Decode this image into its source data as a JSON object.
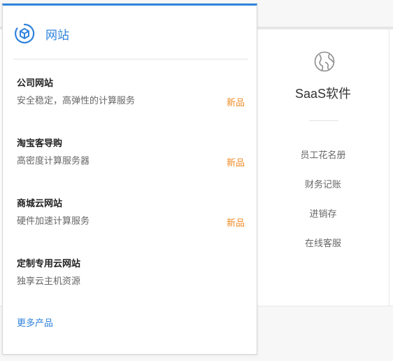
{
  "panel": {
    "title": "网站",
    "icon": "website-cube-icon",
    "accent_color": "#2f83db",
    "products": [
      {
        "name": "公司网站",
        "desc": "安全稳定，高弹性的计算服务",
        "badge": "新品"
      },
      {
        "name": "淘宝客导购",
        "desc": "高密度计算服务器",
        "badge": "新品"
      },
      {
        "name": "商城云网站",
        "desc": "硬件加速计算服务",
        "badge": "新品"
      },
      {
        "name": "定制专用云网站",
        "desc": "独享云主机资源",
        "badge": ""
      }
    ],
    "more_label": "更多产品",
    "badge_color": "#f08a24"
  },
  "saas": {
    "icon": "globe-icon",
    "title": "SaaS软件",
    "links": [
      "员工花名册",
      "财务记账",
      "进销存",
      "在线客服"
    ]
  }
}
